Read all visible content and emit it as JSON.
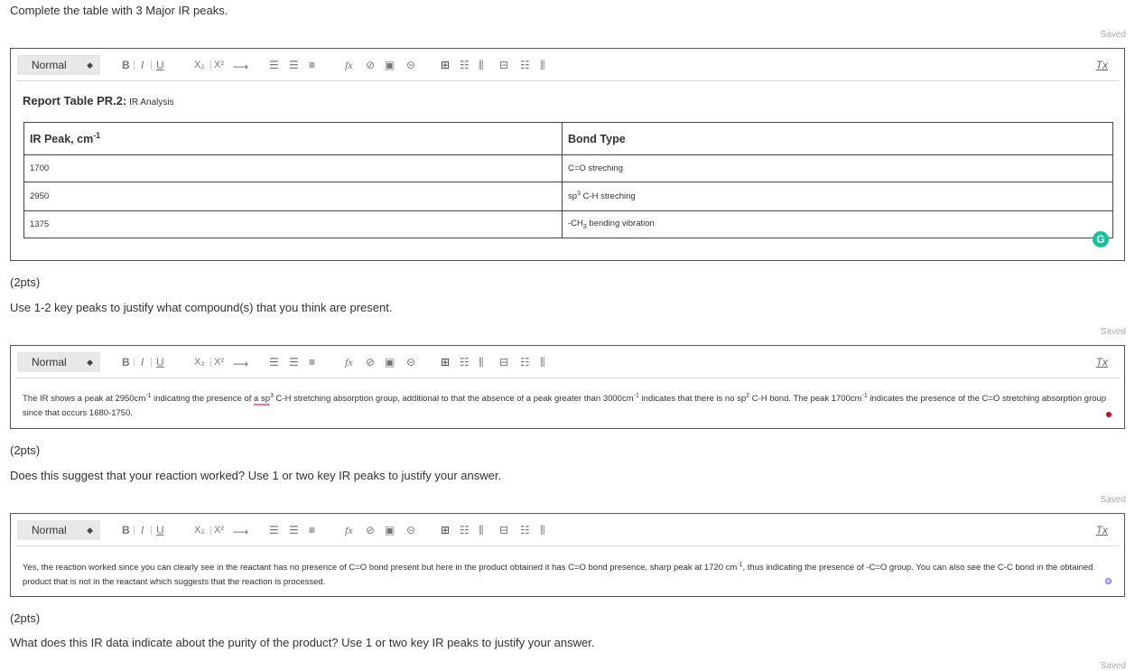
{
  "q1": {
    "prompt": "Complete the table with 3 Major IR peaks.",
    "saved": "Saved"
  },
  "toolbar": {
    "format": "Normal",
    "bold": "B",
    "italic": "I",
    "underline": "U",
    "subscript": "X₂",
    "superscript": "X²",
    "arrow": "⟶",
    "formula": "fx",
    "clear": "Tx"
  },
  "table": {
    "title_bold": "Report Table PR.2:",
    "title_rest": " IR Analysis",
    "header_peak": "IR Peak, cm",
    "header_peak_sup": "-1",
    "header_bond": "Bond Type",
    "rows": [
      {
        "peak": "1700",
        "bond_pre": "C=O streching",
        "bond_mid": "",
        "bond_post": ""
      },
      {
        "peak": "2950",
        "bond_pre": "sp",
        "bond_mid": "3",
        "bond_post": " C-H streching"
      },
      {
        "peak": "1375",
        "bond_pre": "-CH",
        "bond_mid": "3",
        "bond_post": " bending vibration"
      }
    ],
    "grammarly": "G"
  },
  "q2": {
    "points": "(2pts)",
    "prompt": "Use 1-2 key peaks to justify what compound(s) that you think are present.",
    "saved": "Saved",
    "answer": {
      "p1": "The IR shows a peak at 2950cm",
      "s1": "-1",
      "p2": " indicating the presence of ",
      "p3": "a sp",
      "s2": "3",
      "p4": " C-H stretching absorption group, additional to that the absence of a peak greater than 3000cm",
      "s3": "-1",
      "p5": " indicates that there is no sp",
      "s4": "2",
      "p6": " C-H bond. The peak 1700cm",
      "s5": "-1",
      "p7": " indicates the presence of the C=O stretching absorption group since that occurs 1680-1750."
    }
  },
  "q3": {
    "points": "(2pts)",
    "prompt": "Does this suggest that your reaction worked? Use 1 or two key IR peaks to justify your answer.",
    "saved": "Saved",
    "answer": {
      "p1": "Yes, the reaction worked since you can clearly see in the reactant has no presence of C=O bond present but here in the product obtained it has C=O bond presence, sharp peak at 1720 cm",
      "s1": "-1",
      "p2": ", thus indicating the presence of -C=O group. You can also see the C-C bond in the obtained product that is not in the reactant which suggests that the reaction is processed."
    }
  },
  "q4": {
    "points": "(2pts)",
    "prompt": "What does this IR data indicate about the purity of the product? Use 1 or two key IR peaks to justify your answer.",
    "saved": "Saved"
  },
  "colors": {
    "grammarly": "#15c39a",
    "spell_underline": "#e8789a",
    "dot_red": "#d0021b",
    "dot_blue": "#6a6adf"
  }
}
